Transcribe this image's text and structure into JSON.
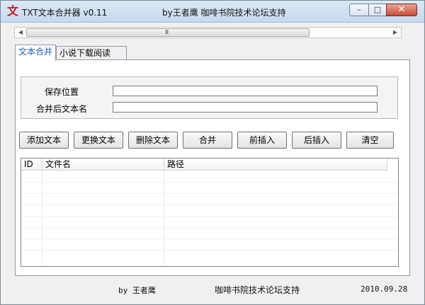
{
  "window": {
    "title": "TXT文本合并器 v0.11",
    "title_center": "by王者鹰 咖啡书院技术论坛支持",
    "icon": "文",
    "controls": {
      "minimize": "–",
      "maximize": "□",
      "close": "✕"
    }
  },
  "scrollbar": {
    "left": "◀",
    "right": "▶",
    "grip": "III"
  },
  "tabs": [
    {
      "label": "文本合并",
      "active": true
    },
    {
      "label": "小说下载阅读",
      "active": false
    }
  ],
  "form": {
    "save_label": "保存位置",
    "save_value": "",
    "name_label": "合并后文本名",
    "name_value": ""
  },
  "buttons": [
    {
      "label": "添加文本"
    },
    {
      "label": "更换文本"
    },
    {
      "label": "删除文本"
    },
    {
      "label": "合并"
    },
    {
      "label": "前插入"
    },
    {
      "label": "后插入"
    },
    {
      "label": "清空"
    }
  ],
  "table": {
    "columns": [
      "ID",
      "文件名",
      "路径"
    ],
    "rows": []
  },
  "statusbar": {
    "author": "by 王者鹰",
    "support": "咖啡书院技术论坛支持",
    "date": "2010.09.28"
  }
}
